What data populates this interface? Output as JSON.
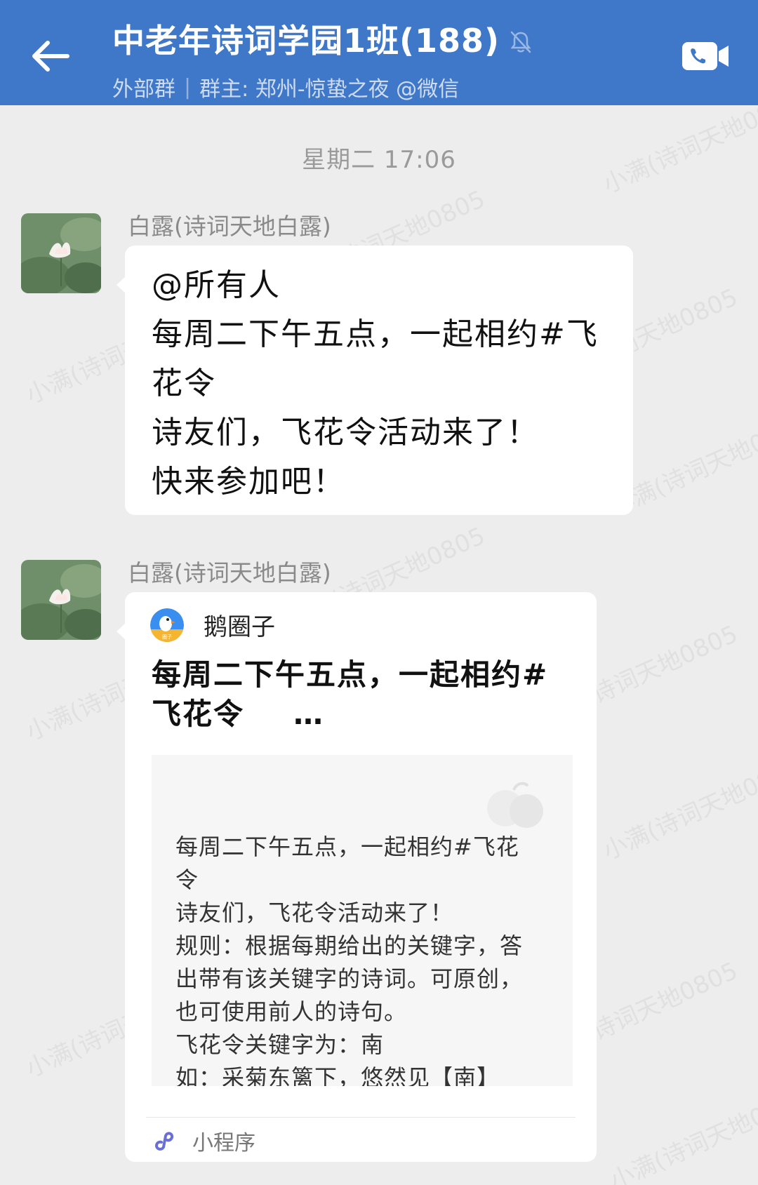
{
  "header": {
    "title": "中老年诗词学园1班(188)",
    "group_type": "外部群",
    "owner": "群主: 郑州-惊蛰之夜 @微信",
    "bar_color": "#3f78c8"
  },
  "timestamp": "星期二  17:06",
  "messages": [
    {
      "sender": "白露(诗词天地白露)",
      "lines": [
        "@所有人",
        "每周二下午五点，一起相约#飞",
        "花令",
        "诗友们，飞花令活动来了！",
        "快来参加吧！"
      ]
    },
    {
      "sender": "白露(诗词天地白露)",
      "card": {
        "app_name": "鹅圈子",
        "app_logo_text": "圈子",
        "title_line1": "每周二下午五点，一起相约#",
        "title_line2": "飞花令",
        "title_ellipsis": "…",
        "preview_lines": [
          "每周二下午五点，一起相约#飞花",
          "令",
          "诗友们，飞花令活动来了！",
          "规则：根据每期给出的关键字，答",
          "出带有该关键字的诗词。可原创，",
          "也可使用前人的诗句。",
          "飞花令关键字为：南",
          "如：采菊东篱下，悠然见【南】"
        ],
        "footer_label": "小程序"
      }
    }
  ],
  "watermark": "小满(诗词天地0805",
  "icons": {
    "back": "back-arrow-icon",
    "mute": "mute-bell-icon",
    "call": "video-call-icon",
    "mini_program": "mini-program-icon"
  }
}
